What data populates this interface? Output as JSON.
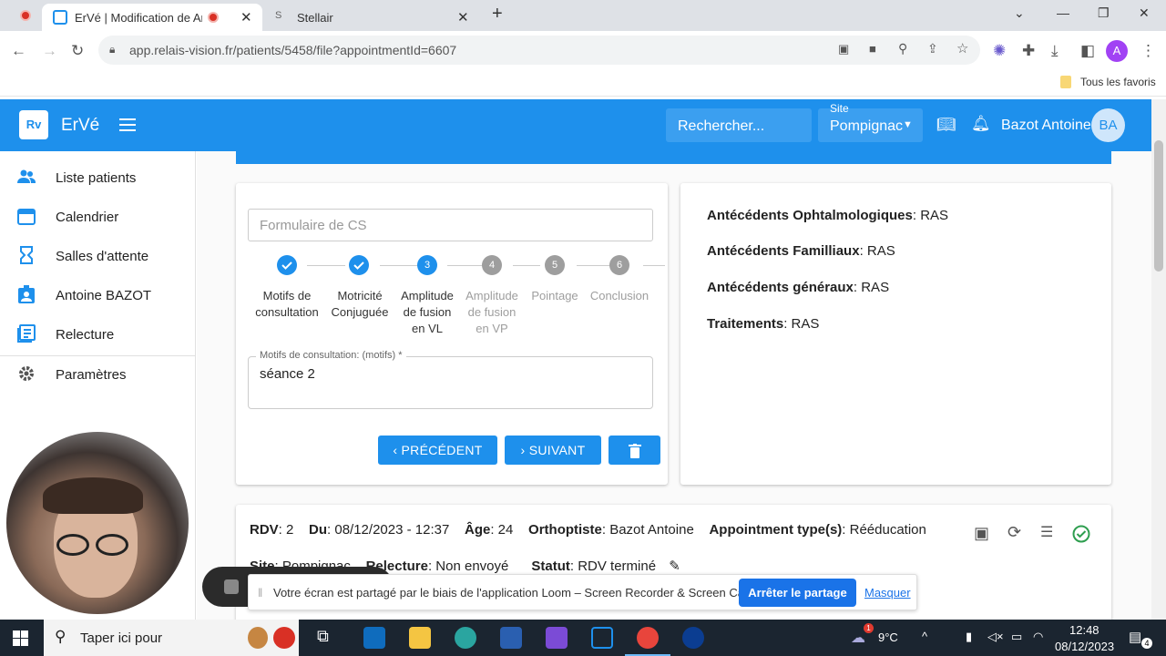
{
  "browser": {
    "tabs": [
      {
        "title": "ErVé | Modification de Anto"
      },
      {
        "title": "Stellair"
      }
    ],
    "url": "app.relais-vision.fr/patients/5458/file?appointmentId=6607",
    "bookmarks_label": "Tous les favoris",
    "profile_initial": "A"
  },
  "header": {
    "logo": "Rv",
    "app_name": "ErVé",
    "search_label": "Rechercher...",
    "site_label": "Site",
    "site_value": "Pompignac",
    "user_name": "Bazot Antoine",
    "avatar_initials": "BA"
  },
  "sidebar": {
    "items": [
      {
        "label": "Liste patients",
        "icon": "people-icon"
      },
      {
        "label": "Calendrier",
        "icon": "calendar-icon"
      },
      {
        "label": "Salles d'attente",
        "icon": "hourglass-icon"
      },
      {
        "label": "Antoine BAZOT",
        "icon": "badge-icon"
      },
      {
        "label": "Relecture",
        "icon": "list-icon"
      },
      {
        "label": "Paramètres",
        "icon": "gear-icon"
      }
    ]
  },
  "form": {
    "placeholder": "Formulaire de CS",
    "steps": [
      {
        "label_lines": [
          "Motifs de",
          "consultation"
        ],
        "state": "done"
      },
      {
        "label_lines": [
          "Motricité",
          "Conjuguée"
        ],
        "state": "done"
      },
      {
        "number": "3",
        "label_lines": [
          "Amplitude",
          "de fusion",
          "en VL"
        ],
        "state": "active"
      },
      {
        "number": "4",
        "label_lines": [
          "Amplitude",
          "de fusion",
          "en VP"
        ],
        "state": "inactive"
      },
      {
        "number": "5",
        "label_lines": [
          "Pointage"
        ],
        "state": "inactive"
      },
      {
        "number": "6",
        "label_lines": [
          "Conclusion"
        ],
        "state": "inactive"
      }
    ],
    "field_label": "Motifs de consultation: (motifs) *",
    "field_value": "séance 2",
    "prev_label": "PRÉCÉDENT",
    "next_label": "SUIVANT"
  },
  "history": [
    {
      "key": "Antécédents Ophtalmologiques",
      "value": ": RAS"
    },
    {
      "key": "Antécédents Familliaux",
      "value": ": RAS"
    },
    {
      "key": "Antécédents généraux",
      "value": ": RAS"
    },
    {
      "key": "Traitements",
      "value": ": RAS"
    }
  ],
  "appointment": {
    "rdv_key": "RDV",
    "rdv_value": ": 2",
    "du_key": "Du",
    "du_value": ": 08/12/2023 - 12:37",
    "age_key": "Âge",
    "age_value": ": 24",
    "ortho_key": "Orthoptiste",
    "ortho_value": ": Bazot Antoine",
    "type_key": "Appointment type(s)",
    "type_value": ": Rééducation",
    "site_key": "Site",
    "site_value": ": Pompignac",
    "relecture_key": "Relecture",
    "relecture_value": ": Non envoyé",
    "statut_key": "Statut",
    "statut_value": ": RDV terminé"
  },
  "share_notice": {
    "text": "Votre écran est partagé par le biais de l'application Loom – Screen Recorder & Screen Capture.",
    "stop_label": "Arrêter le partage",
    "hide_label": "Masquer"
  },
  "taskbar": {
    "search_placeholder": "Taper ici pour",
    "temperature": "9°C",
    "time": "12:48",
    "date": "08/12/2023",
    "notifications": "4",
    "weather_badge": "1"
  },
  "colors": {
    "primary": "#1e90ec",
    "success": "#2e9e4f",
    "taskbar": "#1b2530"
  }
}
